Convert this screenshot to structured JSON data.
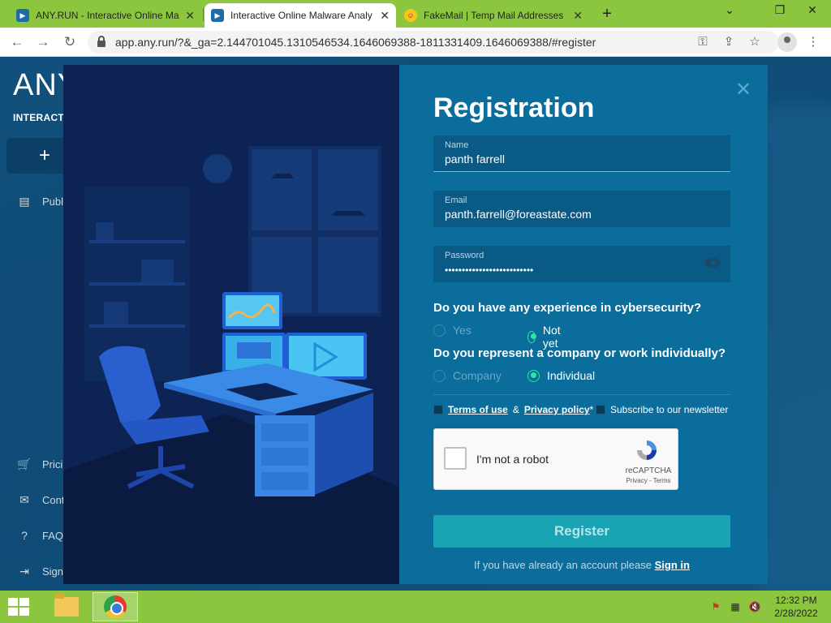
{
  "browser": {
    "tabs": [
      {
        "title": "ANY.RUN - Interactive Online Ma",
        "active": false
      },
      {
        "title": "Interactive Online Malware Analy",
        "active": true
      },
      {
        "title": "FakeMail | Temp Mail Addresses",
        "active": false
      }
    ],
    "url": "app.any.run/?&_ga=2.144701045.1310546534.1646069388-1811331409.1646069388/#register"
  },
  "app": {
    "brand": "ANY",
    "brand_sub": "INTERACTIVE",
    "new_button": "+ N",
    "sidebar": [
      {
        "label": "Publ",
        "icon": "document-icon"
      },
      {
        "label": "Prici",
        "icon": "cart-icon"
      },
      {
        "label": "Cont",
        "icon": "mail-icon"
      },
      {
        "label": "FAQ",
        "icon": "help-icon"
      },
      {
        "label": "Sign",
        "icon": "sign-in-icon"
      }
    ]
  },
  "registration": {
    "title": "Registration",
    "name": {
      "label": "Name",
      "value": "panth farrell"
    },
    "email": {
      "label": "Email",
      "value": "panth.farrell@foreastate.com"
    },
    "password": {
      "label": "Password",
      "value": "••••••••••••••••••••••••••"
    },
    "q1": {
      "text": "Do you have any experience in cybersecurity?",
      "options": [
        "Yes",
        "Not yet"
      ],
      "selected": "Not yet"
    },
    "q2": {
      "text": "Do you represent a company or work individually?",
      "options": [
        "Company",
        "Individual"
      ],
      "selected": "Individual"
    },
    "terms": "Terms of use",
    "amp": "&",
    "privacy": "Privacy policy",
    "privacy_mark": "*",
    "newsletter": "Subscribe to our newsletter",
    "captcha": {
      "text": "I'm not a robot",
      "brand": "reCAPTCHA",
      "links": "Privacy - Terms"
    },
    "register_button": "Register",
    "signin_prefix": "If you have already an account please",
    "signin_link": "Sign in"
  },
  "taskbar": {
    "time": "12:32 PM",
    "date": "2/28/2022"
  },
  "colors": {
    "chrome_green": "#8cc63f",
    "panel": "#0b6d9c",
    "accent": "#2ee6a4",
    "register": "#1aa3b2"
  }
}
